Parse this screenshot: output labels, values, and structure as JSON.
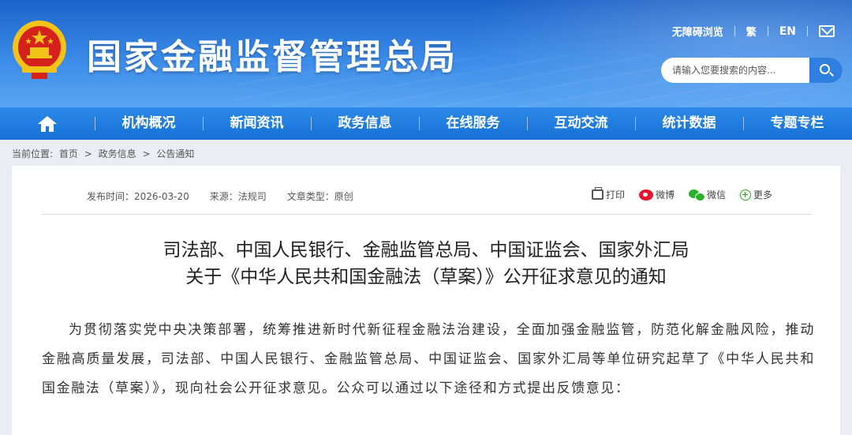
{
  "header": {
    "site_title": "国家金融监督管理总局",
    "links": {
      "accessibility": "无障碍浏览",
      "traditional": "繁",
      "english": "EN"
    },
    "icons": {
      "mail": "mail-icon",
      "search": "search-icon",
      "emblem": "national-emblem-icon"
    },
    "search": {
      "placeholder": "请输入您要搜索的内容..."
    }
  },
  "nav": {
    "items": [
      {
        "label": "机构概况"
      },
      {
        "label": "新闻资讯"
      },
      {
        "label": "政务信息"
      },
      {
        "label": "在线服务"
      },
      {
        "label": "互动交流"
      },
      {
        "label": "统计数据"
      },
      {
        "label": "专题专栏"
      }
    ]
  },
  "breadcrumb": {
    "prefix": "当前位置:",
    "home": "首页",
    "sep1": ">",
    "section": "政务信息",
    "sep2": ">",
    "current": "公告通知"
  },
  "article": {
    "publish_time": "发布时间：2026-03-20",
    "source": "来源：法规司",
    "doc_type": "文章类型：原创",
    "share": {
      "print": "打印",
      "weibo": "微博",
      "wechat": "微信",
      "more": "更多"
    },
    "title_line1": "司法部、中国人民银行、金融监管总局、中国证监会、国家外汇局",
    "title_line2": "关于《中华人民共和国金融法（草案）》公开征求意见的通知",
    "paragraph": "为贯彻落实党中央决策部署，统筹推进新时代新征程金融法治建设，全面加强金融监管，防范化解金融风险，推动金融高质量发展，司法部、中国人民银行、金融监管总局、中国证监会、国家外汇局等单位研究起草了《中华人民共和国金融法（草案）》，现向社会公开征求意见。公众可以通过以下途径和方式提出反馈意见："
  },
  "colors": {
    "header_blue": "#1c63c9",
    "nav_blue": "#1670d6",
    "emblem_red": "#d4211c",
    "emblem_gold": "#f3c319"
  }
}
